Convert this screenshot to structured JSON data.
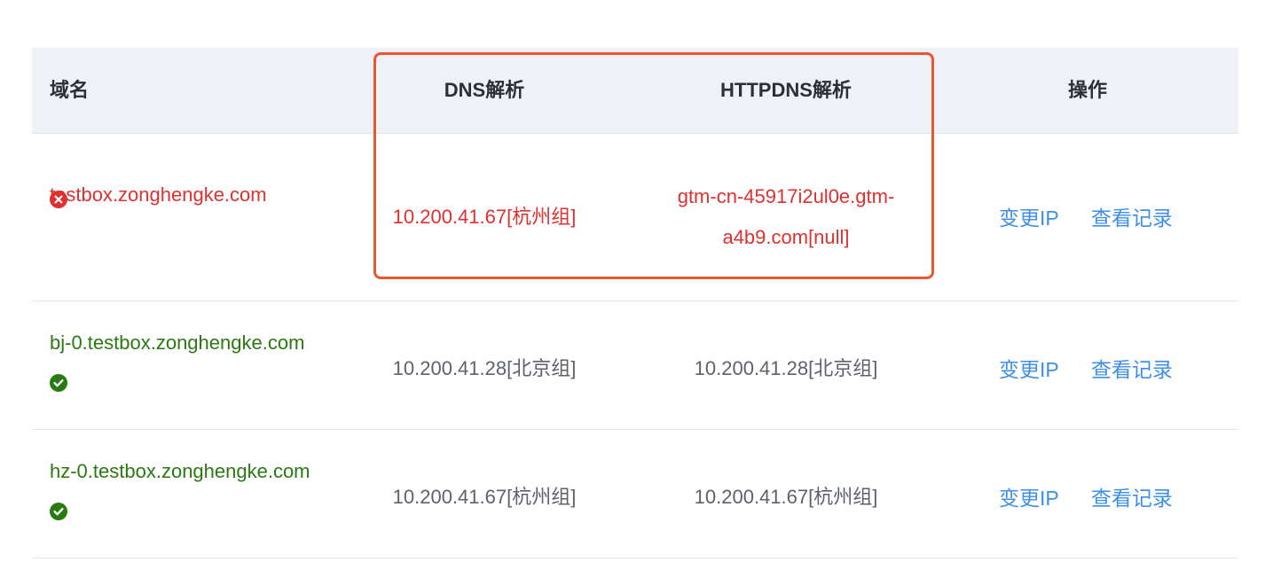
{
  "table": {
    "headers": {
      "domain": "域名",
      "dns": "DNS解析",
      "httpdns": "HTTPDNS解析",
      "actions": "操作"
    },
    "rows": [
      {
        "domain": "testbox.zonghengke.com",
        "status": "error",
        "status_icon": "error-circle-icon",
        "dns": "10.200.41.67[杭州组]",
        "httpdns": "gtm-cn-45917i2ul0e.gtm-a4b9.com[null]",
        "action_change_ip": "变更IP",
        "action_view_log": "查看记录"
      },
      {
        "domain": "bj-0.testbox.zonghengke.com",
        "status": "ok",
        "status_icon": "check-circle-icon",
        "dns": "10.200.41.28[北京组]",
        "httpdns": "10.200.41.28[北京组]",
        "action_change_ip": "变更IP",
        "action_view_log": "查看记录"
      },
      {
        "domain": "hz-0.testbox.zonghengke.com",
        "status": "ok",
        "status_icon": "check-circle-icon",
        "dns": "10.200.41.67[杭州组]",
        "httpdns": "10.200.41.67[杭州组]",
        "action_change_ip": "变更IP",
        "action_view_log": "查看记录"
      }
    ]
  },
  "colors": {
    "error": "#e0302f",
    "ok": "#2a7a12",
    "link": "#3d8fe8",
    "header_bg": "#eef1f6",
    "highlight": "#ea5532"
  }
}
